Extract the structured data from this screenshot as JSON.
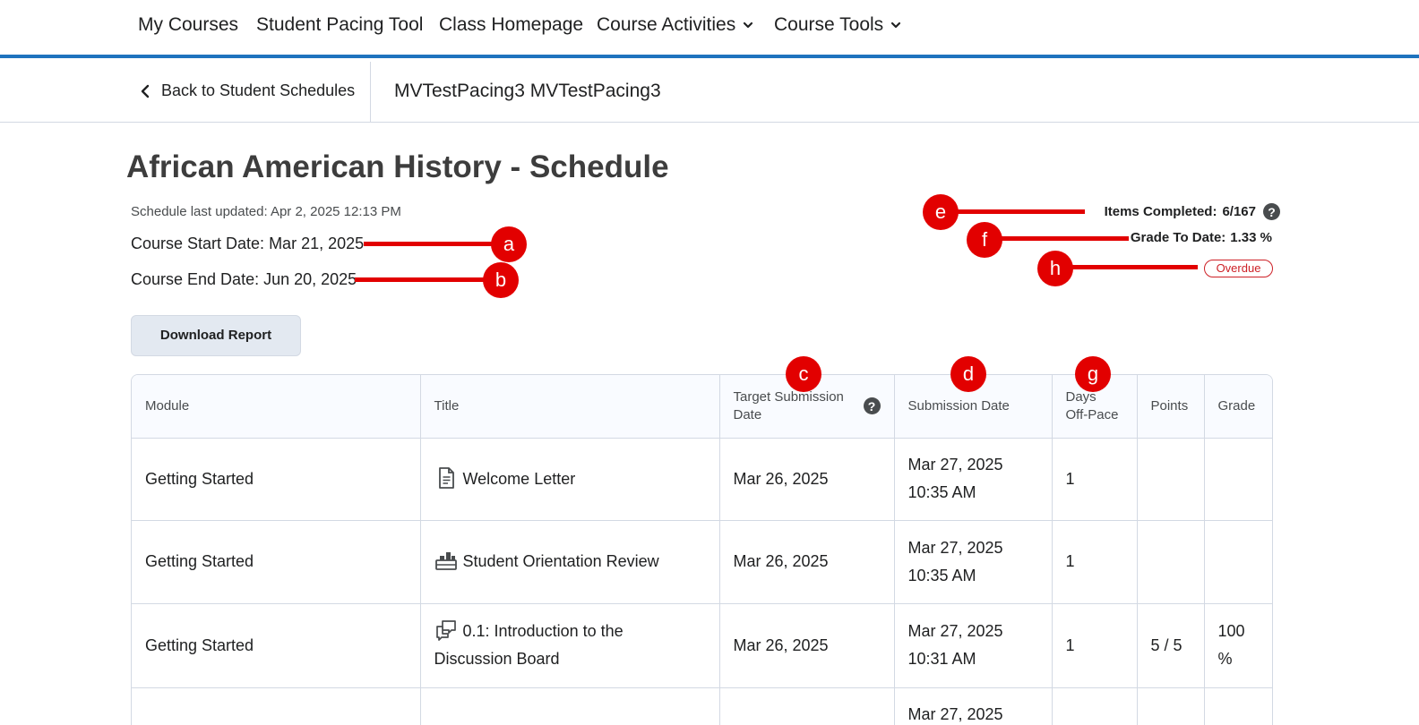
{
  "nav": {
    "items": [
      {
        "label": "My Courses"
      },
      {
        "label": "Student Pacing Tool"
      },
      {
        "label": "Class Homepage"
      },
      {
        "label": "Course Activities",
        "dropdown": true
      },
      {
        "label": "Course Tools",
        "dropdown": true
      }
    ]
  },
  "subbar": {
    "back_label": "Back to Student Schedules",
    "student_name": "MVTestPacing3 MVTestPacing3"
  },
  "page": {
    "title": "African American History - Schedule",
    "last_updated": "Schedule last updated: Apr 2, 2025 12:13 PM",
    "start_date": "Course Start Date: Mar 21, 2025",
    "end_date": "Course End Date: Jun 20, 2025",
    "items_completed_label": "Items Completed:",
    "items_completed_value": "6/167",
    "grade_to_date_label": "Grade To Date:",
    "grade_to_date_value": "1.33 %",
    "status_badge": "Overdue",
    "download_label": "Download Report"
  },
  "table": {
    "headers": {
      "module": "Module",
      "title": "Title",
      "target_line1": "Target Submission",
      "target_line2": "Date",
      "submission": "Submission Date",
      "days_line1": "Days",
      "days_line2": "Off-Pace",
      "points": "Points",
      "grade": "Grade"
    },
    "rows": [
      {
        "module": "Getting Started",
        "icon": "document-icon",
        "title": "Welcome Letter",
        "target": "Mar 26, 2025",
        "sub_date": "Mar 27, 2025",
        "sub_time": "10:35 AM",
        "days": "1",
        "points": "",
        "grade_l1": "",
        "grade_l2": ""
      },
      {
        "module": "Getting Started",
        "icon": "quiz-icon",
        "title": "Student Orientation Review",
        "target": "Mar 26, 2025",
        "sub_date": "Mar 27, 2025",
        "sub_time": "10:35 AM",
        "days": "1",
        "points": "",
        "grade_l1": "",
        "grade_l2": ""
      },
      {
        "module": "Getting Started",
        "icon": "discussion-icon",
        "title": "0.1: Introduction to the Discussion Board",
        "target": "Mar 26, 2025",
        "sub_date": "Mar 27, 2025",
        "sub_time": "10:31 AM",
        "days": "1",
        "points": "5 / 5",
        "grade_l1": "100",
        "grade_l2": "%"
      },
      {
        "module": "",
        "icon": "",
        "title": "",
        "target": "",
        "sub_date": "Mar 27, 2025",
        "sub_time": "",
        "days": "",
        "points": "",
        "grade_l1": "",
        "grade_l2": ""
      }
    ]
  },
  "annotations": {
    "a": "a",
    "b": "b",
    "c": "c",
    "d": "d",
    "e": "e",
    "f": "f",
    "g": "g",
    "h": "h"
  },
  "colors": {
    "accent": "#1e73be",
    "annotation": "#e20000",
    "overdue": "#cd2026"
  }
}
